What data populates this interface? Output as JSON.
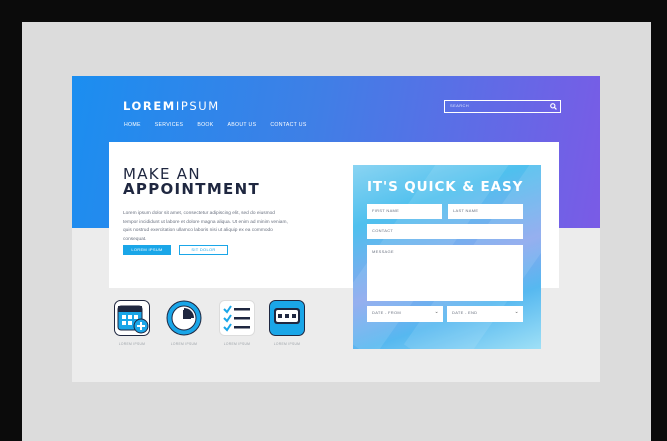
{
  "header": {
    "logo_bold": "LOREM",
    "logo_light": "IPSUM",
    "search_placeholder": "SEARCH",
    "nav": [
      "HOME",
      "SERVICES",
      "BOOK",
      "ABOUT US",
      "CONTACT US"
    ]
  },
  "hero": {
    "title_line1": "MAKE AN",
    "title_line2": "APPOINTMENT",
    "body": "Lorem ipsum dolor sit amet, consectetur adipiscing elit, sed do eiusmod tempor incididunt ut labore et dolore magna aliqua. Ut enim ad minim veniam, quis nostrud exercitation ullamco laboris nisi ut aliquip ex ea commodo consequat.",
    "primary_button": "LOREM IPSUM",
    "secondary_button": "SIT DOLOR"
  },
  "form": {
    "title": "IT'S QUICK & EASY",
    "first_name": "FIRST NAME",
    "last_name": "LAST NAME",
    "contact": "CONTACT",
    "message": "MESSAGE",
    "date_from": "DATE - FROM",
    "date_end": "DATE - END"
  },
  "icons": [
    {
      "name": "calendar-add-icon",
      "label": "LOREM IPSUM",
      "bg": "#1aa6e8"
    },
    {
      "name": "clock-icon",
      "label": "LOREM IPSUM",
      "bg": "#1aa6e8"
    },
    {
      "name": "checklist-icon",
      "label": "LOREM IPSUM",
      "bg": "#ffffff"
    },
    {
      "name": "chat-icon",
      "label": "LOREM IPSUM",
      "bg": "#1aa6e8"
    }
  ],
  "colors": {
    "accent": "#1aa6e8",
    "gradient_start": "#1b8ef0",
    "gradient_end": "#7a5be6",
    "text_dark": "#1f2740"
  }
}
